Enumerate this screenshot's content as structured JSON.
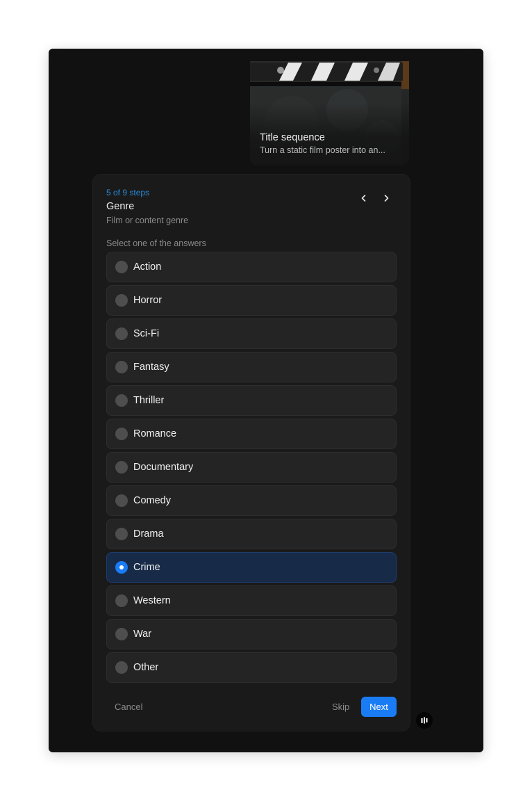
{
  "media_card": {
    "title": "Title sequence",
    "subtitle": "Turn a static film poster into an..."
  },
  "question": {
    "steps": "5 of 9 steps",
    "title": "Genre",
    "subtitle": "Film or content genre",
    "instruction": "Select one of the answers",
    "options": [
      {
        "label": "Action",
        "selected": false
      },
      {
        "label": "Horror",
        "selected": false
      },
      {
        "label": "Sci-Fi",
        "selected": false
      },
      {
        "label": "Fantasy",
        "selected": false
      },
      {
        "label": "Thriller",
        "selected": false
      },
      {
        "label": "Romance",
        "selected": false
      },
      {
        "label": "Documentary",
        "selected": false
      },
      {
        "label": "Comedy",
        "selected": false
      },
      {
        "label": "Drama",
        "selected": false
      },
      {
        "label": "Crime",
        "selected": true
      },
      {
        "label": "Western",
        "selected": false
      },
      {
        "label": "War",
        "selected": false
      },
      {
        "label": "Other",
        "selected": false
      }
    ]
  },
  "footer": {
    "cancel_label": "Cancel",
    "skip_label": "Skip",
    "next_label": "Next"
  },
  "icons": {
    "prev": "chevron-left-icon",
    "next": "chevron-right-icon",
    "brand": "brand-logo-icon"
  },
  "colors": {
    "accent": "#1a7cf5",
    "steps_text": "#2a8ad8",
    "selected_bg": "#172a48"
  }
}
